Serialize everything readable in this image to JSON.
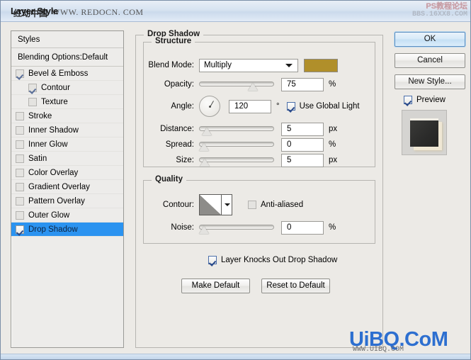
{
  "window": {
    "title": "Layer Style",
    "watermark_title_cn": "红动中国",
    "watermark_title_url": "WWW. REDOCN. COM",
    "watermark_top_right_1": "PS教程论坛",
    "watermark_top_right_2": "BBS.16XX8.COM",
    "watermark_bottom": "UiBQ.CoM",
    "watermark_bottom_sub": "WWW.UIBQ.COM"
  },
  "styles_panel": {
    "header": "Styles",
    "blending_options": "Blending Options:Default",
    "items": [
      {
        "label": "Bevel & Emboss",
        "checked": true,
        "indent": false,
        "selected": false
      },
      {
        "label": "Contour",
        "checked": true,
        "indent": true,
        "selected": false
      },
      {
        "label": "Texture",
        "checked": false,
        "indent": true,
        "selected": false
      },
      {
        "label": "Stroke",
        "checked": false,
        "indent": false,
        "selected": false
      },
      {
        "label": "Inner Shadow",
        "checked": false,
        "indent": false,
        "selected": false
      },
      {
        "label": "Inner Glow",
        "checked": false,
        "indent": false,
        "selected": false
      },
      {
        "label": "Satin",
        "checked": false,
        "indent": false,
        "selected": false
      },
      {
        "label": "Color Overlay",
        "checked": false,
        "indent": false,
        "selected": false
      },
      {
        "label": "Gradient Overlay",
        "checked": false,
        "indent": false,
        "selected": false
      },
      {
        "label": "Pattern Overlay",
        "checked": false,
        "indent": false,
        "selected": false
      },
      {
        "label": "Outer Glow",
        "checked": false,
        "indent": false,
        "selected": false
      },
      {
        "label": "Drop Shadow",
        "checked": true,
        "indent": false,
        "selected": true
      }
    ]
  },
  "main": {
    "section_title": "Drop Shadow",
    "structure": {
      "legend": "Structure",
      "blend_mode_label": "Blend Mode:",
      "blend_mode_value": "Multiply",
      "shadow_color": "#b08f2a",
      "opacity_label": "Opacity:",
      "opacity_value": "75",
      "opacity_unit": "%",
      "opacity_percent": 75,
      "angle_label": "Angle:",
      "angle_value": "120",
      "angle_unit": "°",
      "use_global_light_label": "Use Global Light",
      "use_global_light_checked": true,
      "distance_label": "Distance:",
      "distance_value": "5",
      "distance_unit": "px",
      "distance_percent": 4,
      "spread_label": "Spread:",
      "spread_value": "0",
      "spread_unit": "%",
      "spread_percent": 0,
      "size_label": "Size:",
      "size_value": "5",
      "size_unit": "px",
      "size_percent": 1
    },
    "quality": {
      "legend": "Quality",
      "contour_label": "Contour:",
      "anti_aliased_label": "Anti-aliased",
      "anti_aliased_checked": false,
      "noise_label": "Noise:",
      "noise_value": "0",
      "noise_unit": "%",
      "noise_percent": 0
    },
    "layer_knocks_out_label": "Layer Knocks Out Drop Shadow",
    "layer_knocks_out_checked": true,
    "make_default_label": "Make Default",
    "reset_to_default_label": "Reset to Default"
  },
  "right_panel": {
    "ok_label": "OK",
    "cancel_label": "Cancel",
    "new_style_label": "New Style...",
    "preview_label": "Preview",
    "preview_checked": true
  }
}
